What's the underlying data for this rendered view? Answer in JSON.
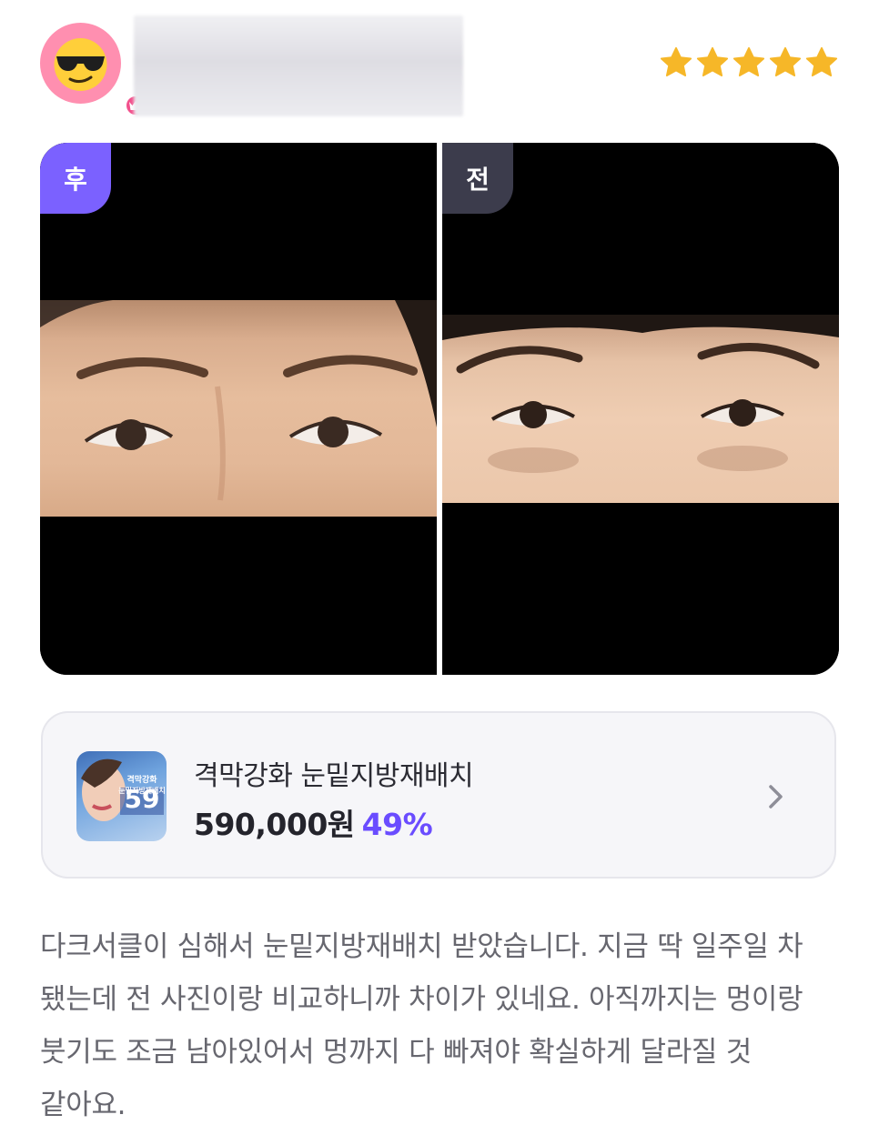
{
  "review": {
    "rating": 5,
    "star_color": "#f6b728",
    "text": "다크서클이 심해서 눈밑지방재배치 받았습니다. 지금 딱 일주일 차 됐는데 전 사진이랑 비교하니까 차이가 있네요. 아직까지는 멍이랑 붓기도 조금 남아있어서 멍까지 다 빠져야 확실하게 달라질 것 같아요."
  },
  "user": {
    "avatar_icon": "sunglasses-emoji-icon",
    "badge_icon": "crown-icon"
  },
  "photos": {
    "after_label": "후",
    "before_label": "전",
    "after_label_color": "#7b61ff",
    "before_label_color": "#3c3c4c"
  },
  "product": {
    "name": "격막강화 눈밑지방재배치",
    "price": "590,000원",
    "discount": "49%",
    "discount_color": "#6a4cff",
    "thumbnail_text": "격막강화\n눈밑지방재배치",
    "thumbnail_number": "59"
  }
}
